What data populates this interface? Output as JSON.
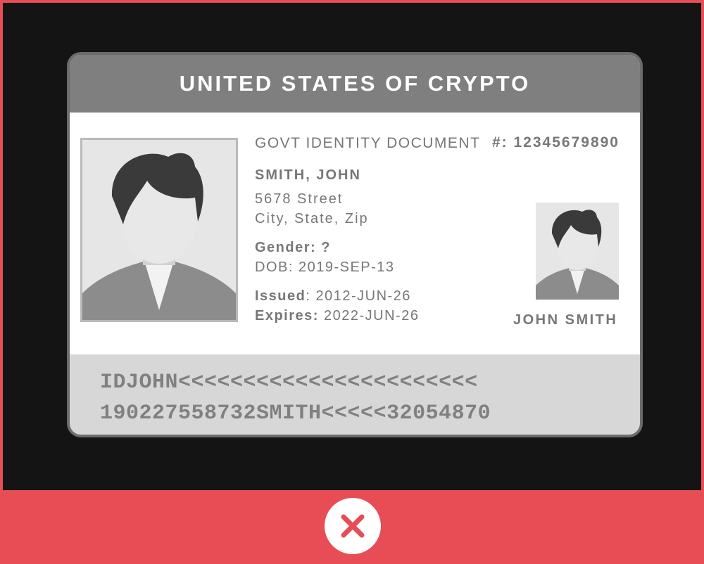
{
  "card": {
    "title": "UNITED STATES OF CRYPTO",
    "document_type": "GOVT IDENTITY DOCUMENT",
    "document_number": "#: 12345679890",
    "holder": {
      "name": "SMITH, JOHN",
      "address_line1": "5678 Street",
      "address_line2": "City, State, Zip",
      "gender_label": "Gender:",
      "gender_value": "?",
      "dob": "DOB: 2019-SEP-13",
      "issued_label": "Issued",
      "issued_value": ": 2012-JUN-26",
      "expires_label": "Expires:",
      "expires_value": "2022-JUN-26",
      "signature_name": "JOHN SMITH"
    },
    "mrz": {
      "line1": "IDJOHN<<<<<<<<<<<<<<<<<<<<<<<",
      "line2": "190227558732SMITH<<<<<32054870"
    }
  },
  "status": {
    "icon": "close-icon",
    "accent_color": "#e84c55"
  }
}
